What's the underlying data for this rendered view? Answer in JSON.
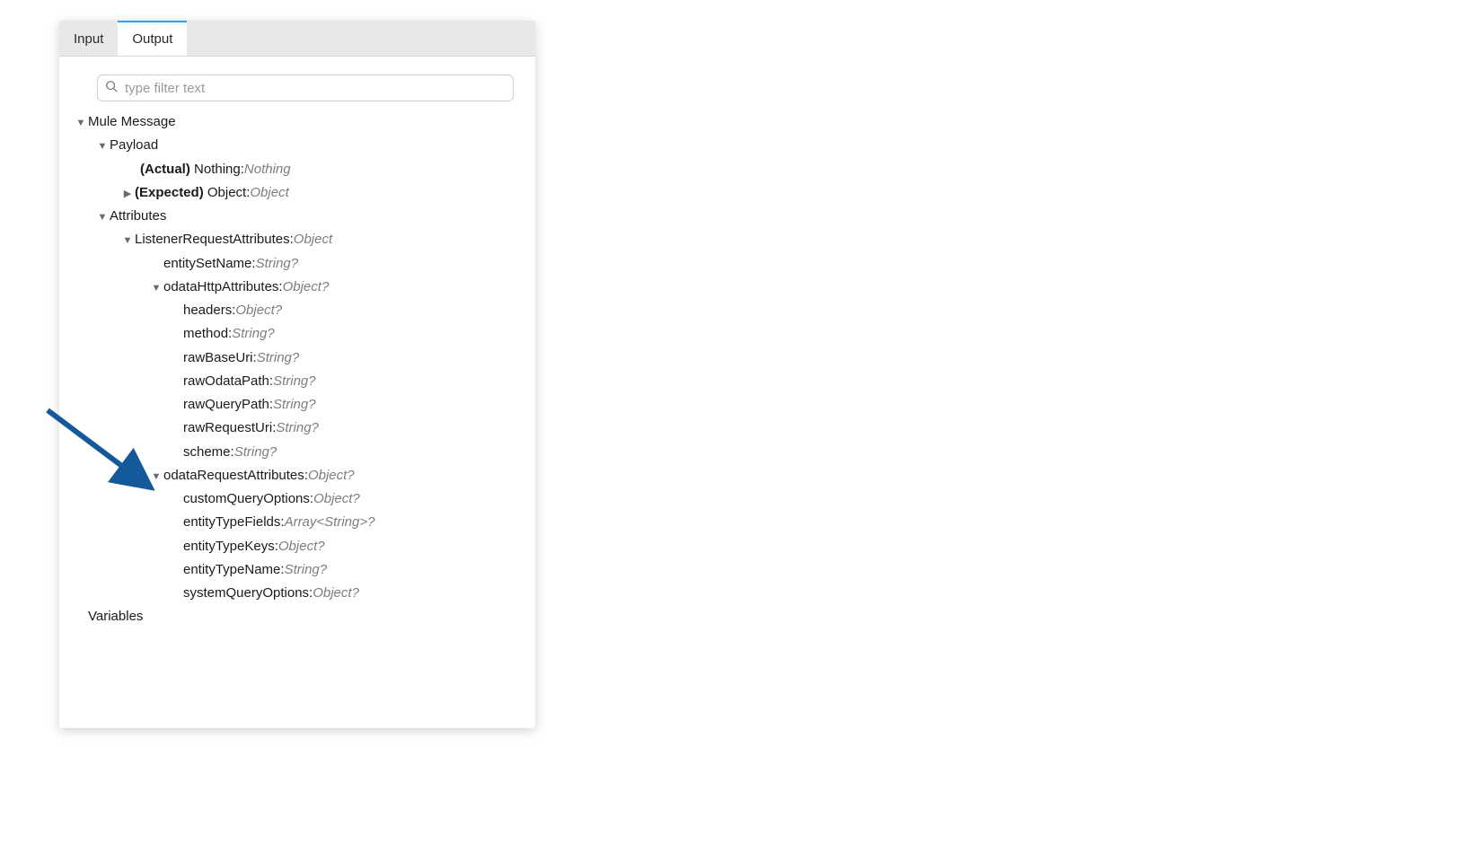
{
  "tabs": {
    "input": "Input",
    "output": "Output"
  },
  "search": {
    "placeholder": "type filter text"
  },
  "tree": {
    "root": "Mule Message",
    "payload": {
      "label": "Payload",
      "actual": {
        "tag": "(Actual)",
        "name": "Nothing",
        "type": "Nothing"
      },
      "expected": {
        "tag": "(Expected)",
        "name": "Object",
        "type": "Object"
      }
    },
    "attributes": {
      "label": "Attributes",
      "lra": {
        "name": "ListenerRequestAttributes",
        "type": "Object"
      },
      "entitySetName": {
        "name": "entitySetName",
        "type": "String?"
      },
      "odataHttp": {
        "name": "odataHttpAttributes",
        "type": "Object?",
        "children": [
          {
            "name": "headers",
            "type": "Object?"
          },
          {
            "name": "method",
            "type": "String?"
          },
          {
            "name": "rawBaseUri",
            "type": "String?"
          },
          {
            "name": "rawOdataPath",
            "type": "String?"
          },
          {
            "name": "rawQueryPath",
            "type": "String?"
          },
          {
            "name": "rawRequestUri",
            "type": "String?"
          },
          {
            "name": "scheme",
            "type": "String?"
          }
        ]
      },
      "odataReq": {
        "name": "odataRequestAttributes",
        "type": "Object?",
        "children": [
          {
            "name": "customQueryOptions",
            "type": "Object?"
          },
          {
            "name": "entityTypeFields",
            "type": "Array<String>?"
          },
          {
            "name": "entityTypeKeys",
            "type": "Object?"
          },
          {
            "name": "entityTypeName",
            "type": "String?"
          },
          {
            "name": "systemQueryOptions",
            "type": "Object?"
          }
        ]
      }
    },
    "variables": "Variables"
  },
  "colon": " : "
}
